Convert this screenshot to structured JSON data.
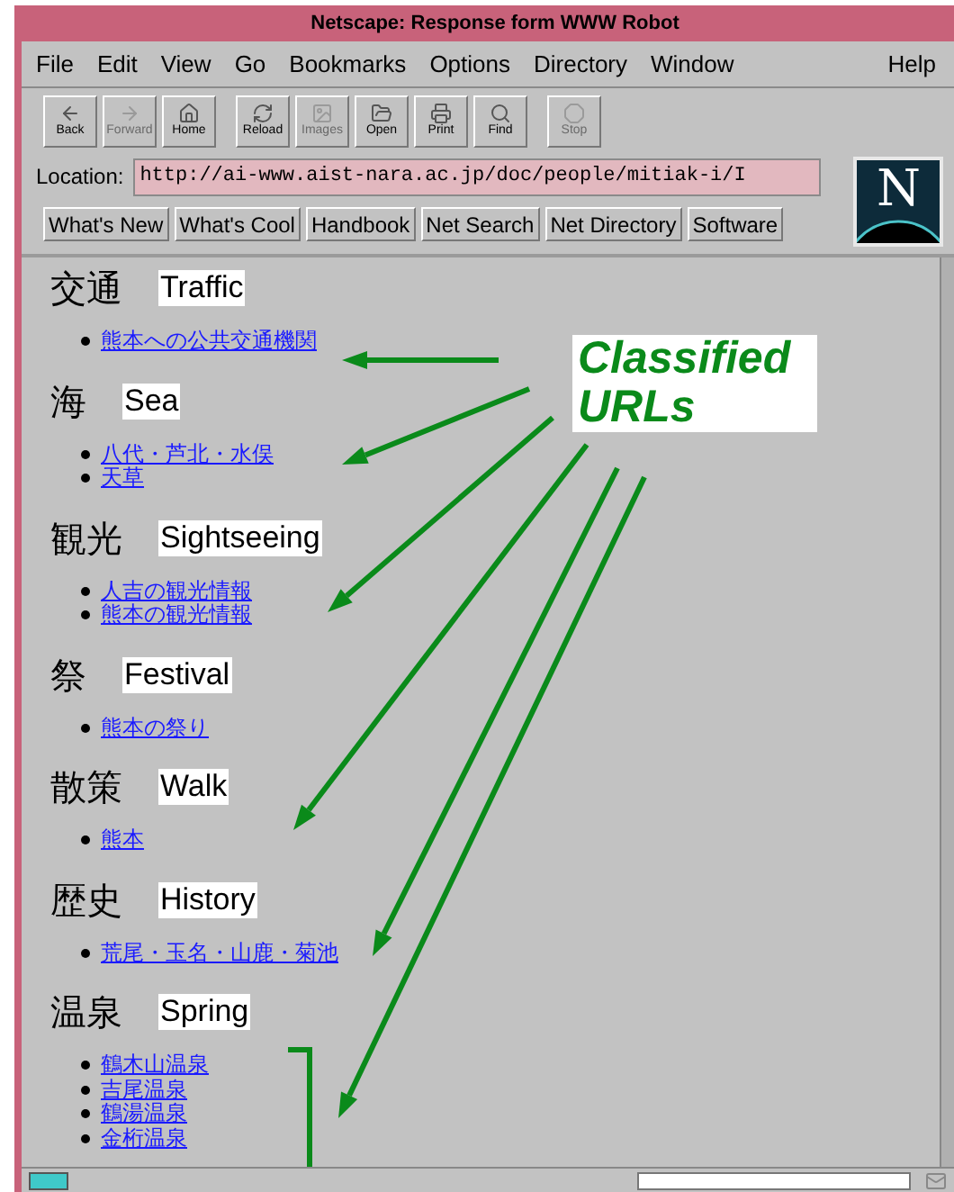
{
  "window": {
    "title": "Netscape: Response form WWW Robot"
  },
  "menu": [
    "File",
    "Edit",
    "View",
    "Go",
    "Bookmarks",
    "Options",
    "Directory",
    "Window"
  ],
  "help_menu": "Help",
  "toolbar": [
    {
      "label": "Back",
      "kind": "back",
      "disabled": false
    },
    {
      "label": "Forward",
      "kind": "forward",
      "disabled": true
    },
    {
      "label": "Home",
      "kind": "home",
      "disabled": false
    },
    {
      "label": "Reload",
      "kind": "reload",
      "disabled": false
    },
    {
      "label": "Images",
      "kind": "images",
      "disabled": true
    },
    {
      "label": "Open",
      "kind": "open",
      "disabled": false
    },
    {
      "label": "Print",
      "kind": "print",
      "disabled": false
    },
    {
      "label": "Find",
      "kind": "find",
      "disabled": false
    },
    {
      "label": "Stop",
      "kind": "stop",
      "disabled": true
    }
  ],
  "location": {
    "label": "Location:",
    "value": "http://ai-www.aist-nara.ac.jp/doc/people/mitiak-i/I"
  },
  "directory_buttons": [
    "What's New",
    "What's Cool",
    "Handbook",
    "Net Search",
    "Net Directory",
    "Software"
  ],
  "sections": [
    {
      "heading": "交通",
      "label": "Traffic",
      "links": [
        "熊本への公共交通機関"
      ]
    },
    {
      "heading": "海",
      "label": "Sea",
      "links": [
        "八代・芦北・水俣",
        "天草"
      ]
    },
    {
      "heading": "観光",
      "label": "Sightseeing",
      "links": [
        "人吉の観光情報",
        "熊本の観光情報"
      ]
    },
    {
      "heading": "祭",
      "label": "Festival",
      "links": [
        "熊本の祭り"
      ]
    },
    {
      "heading": "散策",
      "label": "Walk",
      "links": [
        "熊本"
      ]
    },
    {
      "heading": "歴史",
      "label": "History",
      "links": [
        "荒尾・玉名・山鹿・菊池"
      ]
    },
    {
      "heading": "温泉",
      "label": "Spring",
      "links": [
        "鶴木山温泉",
        "吉尾温泉",
        "鶴湯温泉",
        "金桁温泉"
      ]
    }
  ],
  "logo": "N",
  "annotation": {
    "text": "Classified URLs"
  }
}
